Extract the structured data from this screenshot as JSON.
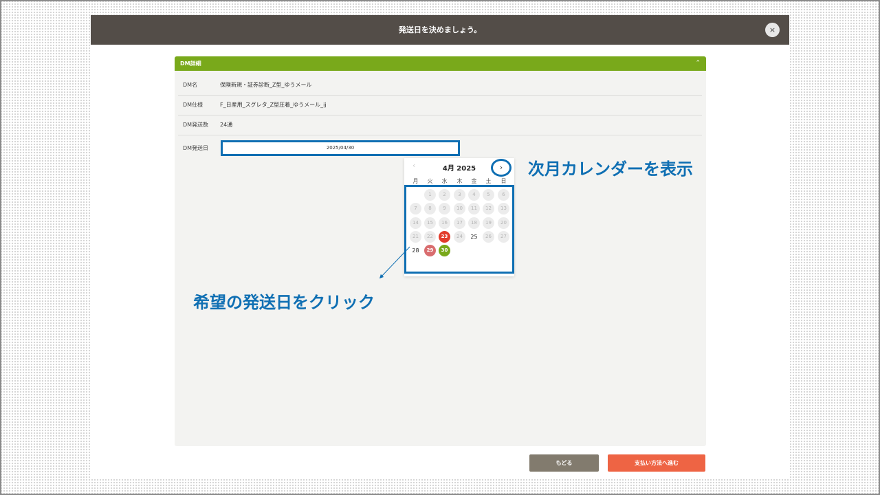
{
  "modal": {
    "title": "発送日を決めましょう。",
    "close_icon": "×"
  },
  "section": {
    "title": "DM詳細",
    "collapse_icon": "⌃"
  },
  "details": [
    {
      "label": "DM名",
      "value": "保険新規・証券診断_Z型_ゆうメール"
    },
    {
      "label": "DM仕様",
      "value": "F_日産用_スグレタ_Z型圧着_ゆうメール_ij"
    },
    {
      "label": "DM発送数",
      "value": "24通"
    }
  ],
  "date_field": {
    "label": "DM発送日",
    "value": "2025/04/30"
  },
  "calendar": {
    "month_label": "4月 2025",
    "prev_icon": "‹",
    "next_icon": "›",
    "weekdays": [
      "月",
      "火",
      "水",
      "木",
      "金",
      "土",
      "日"
    ],
    "days": [
      {
        "d": "1",
        "s": "disabled"
      },
      {
        "d": "2",
        "s": "disabled"
      },
      {
        "d": "3",
        "s": "disabled"
      },
      {
        "d": "4",
        "s": "disabled"
      },
      {
        "d": "5",
        "s": "disabled"
      },
      {
        "d": "6",
        "s": "disabled"
      },
      {
        "d": "7",
        "s": "disabled"
      },
      {
        "d": "8",
        "s": "disabled"
      },
      {
        "d": "9",
        "s": "disabled"
      },
      {
        "d": "10",
        "s": "disabled"
      },
      {
        "d": "11",
        "s": "disabled"
      },
      {
        "d": "12",
        "s": "disabled"
      },
      {
        "d": "13",
        "s": "disabled"
      },
      {
        "d": "14",
        "s": "disabled"
      },
      {
        "d": "15",
        "s": "disabled"
      },
      {
        "d": "16",
        "s": "disabled"
      },
      {
        "d": "17",
        "s": "disabled"
      },
      {
        "d": "18",
        "s": "disabled"
      },
      {
        "d": "19",
        "s": "disabled"
      },
      {
        "d": "20",
        "s": "disabled"
      },
      {
        "d": "21",
        "s": "disabled"
      },
      {
        "d": "22",
        "s": "disabled"
      },
      {
        "d": "23",
        "s": "red"
      },
      {
        "d": "24",
        "s": "disabled"
      },
      {
        "d": "25",
        "s": "plain"
      },
      {
        "d": "26",
        "s": "disabled"
      },
      {
        "d": "27",
        "s": "disabled"
      },
      {
        "d": "28",
        "s": "plain"
      },
      {
        "d": "29",
        "s": "pink"
      },
      {
        "d": "30",
        "s": "green"
      }
    ],
    "first_weekday_index": 1
  },
  "annotations": {
    "next_month": "次月カレンダーを表示",
    "click_date": "希望の発送日をクリック"
  },
  "buttons": {
    "back": "もどる",
    "proceed": "支払い方法へ進む"
  },
  "colors": {
    "header": "#534d48",
    "section_bar": "#79a91b",
    "highlight": "#0f6fb3",
    "proceed": "#ee6444",
    "back": "#827b6e"
  }
}
